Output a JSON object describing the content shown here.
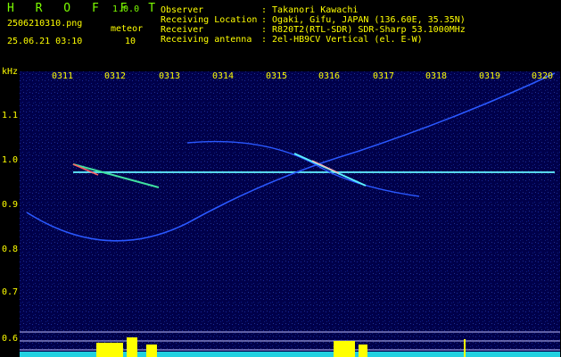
{
  "header": {
    "app_title": "H R O F F T",
    "version": "1.0.0",
    "filename": "2506210310.png",
    "meteor_label": "meteor",
    "meteor_count": "10",
    "datetime": "25.06.21 03:10",
    "info_labels": [
      "Observer",
      "Receiving Location",
      "Receiver",
      "Receiving antenna"
    ],
    "info_values": [
      ": Takanori Kawachi",
      ": Ogaki, Gifu, JAPAN (136.60E, 35.35N)",
      ": R820T2(RTL-SDR) SDR-Sharp 53.1000MHz",
      ": 2el-HB9CV Vertical (el. E-W)"
    ]
  },
  "axis": {
    "unit": "kHz",
    "x_ticks": [
      "0311",
      "0312",
      "0313",
      "0314",
      "0315",
      "0316",
      "0317",
      "0318",
      "0319",
      "0320"
    ],
    "y_ticks": [
      "1.1",
      "1.0",
      "0.9",
      "0.8",
      "0.7",
      "0.6"
    ]
  },
  "colors": {
    "label": "#ffff00",
    "title": "#7cfc00",
    "signal": "#3ad0ff",
    "background": "#00004a"
  }
}
